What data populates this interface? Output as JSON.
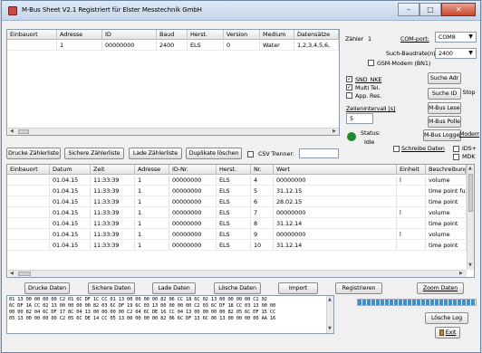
{
  "window": {
    "title": "M-Bus Sheet  V2.1 Registriert für Elster Messtechnik GmbH",
    "minimize_label": "–",
    "maximize_label": "□",
    "close_label": "✕"
  },
  "meters_table": {
    "headers": [
      "Einbauort",
      "Adresse",
      "ID",
      "Baud",
      "Herst.",
      "Version",
      "Medium",
      "Datensätze"
    ],
    "rows": [
      {
        "einbauort": "",
        "adresse": "1",
        "id": "00000000",
        "baud": "2400",
        "herst": "ELS",
        "version": "0",
        "medium": "Water",
        "datensaetze": "1,2,3,4,5,6,"
      }
    ]
  },
  "settings": {
    "zaehler_label": "Zähler",
    "zaehler_value": "1",
    "com_port_label": "COM-port:",
    "com_port_value": "COM8",
    "baud_label": "Such-Baudrate(n)",
    "baud_value": "2400",
    "gsm_label": "GSM-Modem (BN1)",
    "snd_nke_label": "SND_NKE",
    "multi_tel_label": "Multi Tel.",
    "app_res_label": "App. Res.",
    "zeilenintervall_label": "Zeilenintervall [s]",
    "zeilenintervall_value": "5",
    "status_label": "Status:",
    "status_value": "Idle",
    "schreibe_label": "Schreibe Daten",
    "ids_label": "IDS+",
    "mdk_label": "MDK",
    "status_color": "#1e8c2e"
  },
  "buttons": {
    "suche_adr": "Suche Adr",
    "suche_id": "Suche ID",
    "stop": "Stop",
    "mbus_lesen": "M-Bus Lesen",
    "mbus_pollen": "M-Bus Pollen",
    "mbus_loggen": "M-Bus Loggen",
    "modem": "Modem",
    "drucke_zaehlerliste": "Drucke Zählerliste",
    "sichere_zaehlerliste": "Sichere Zählerliste",
    "lade_zaehlerliste": "Lade Zählerliste",
    "duplikate_loeschen": "Duplikate löschen",
    "csv_trenner": "CSV Trenner:",
    "drucke_daten": "Drucke Daten",
    "sichere_daten": "Sichere Daten",
    "lade_daten": "Lade Daten",
    "loesche_daten": "Lösche Daten",
    "import": "Import",
    "registrieren": "Registrieren",
    "zoom_daten": "Zoom Daten",
    "loesche_log": "Lösche Log",
    "exit": "Exit"
  },
  "data_table": {
    "headers": [
      "Einbauort",
      "Datum",
      "Zeit",
      "Adresse",
      "ID-Nr.",
      "Herst.",
      "Nr.",
      "Wert",
      "Einheit",
      "Beschreibung"
    ],
    "rows": [
      {
        "einbauort": "",
        "datum": "01.04.15",
        "zeit": "11:33:39",
        "adresse": "1",
        "id": "00000000",
        "herst": "ELS",
        "nr": "4",
        "wert": "00000000",
        "einheit": "l",
        "beschreibung": "volume"
      },
      {
        "einbauort": "",
        "datum": "01.04.15",
        "zeit": "11:33:39",
        "adresse": "1",
        "id": "00000000",
        "herst": "ELS",
        "nr": "5",
        "wert": "31.12.15",
        "einheit": "",
        "beschreibung": "time point futu"
      },
      {
        "einbauort": "",
        "datum": "01.04.15",
        "zeit": "11:33:39",
        "adresse": "1",
        "id": "00000000",
        "herst": "ELS",
        "nr": "6",
        "wert": "28.02.15",
        "einheit": "",
        "beschreibung": "time point"
      },
      {
        "einbauort": "",
        "datum": "01.04.15",
        "zeit": "11:33:39",
        "adresse": "1",
        "id": "00000000",
        "herst": "ELS",
        "nr": "7",
        "wert": "00000000",
        "einheit": "l",
        "beschreibung": "volume"
      },
      {
        "einbauort": "",
        "datum": "01.04.15",
        "zeit": "11:33:39",
        "adresse": "1",
        "id": "00000000",
        "herst": "ELS",
        "nr": "8",
        "wert": "31.12.14",
        "einheit": "",
        "beschreibung": "time point"
      },
      {
        "einbauort": "",
        "datum": "01.04.15",
        "zeit": "11:33:39",
        "adresse": "1",
        "id": "00000000",
        "herst": "ELS",
        "nr": "9",
        "wert": "00000000",
        "einheit": "l",
        "beschreibung": "volume"
      },
      {
        "einbauort": "",
        "datum": "01.04.15",
        "zeit": "11:33:39",
        "adresse": "1",
        "id": "00000000",
        "herst": "ELS",
        "nr": "10",
        "wert": "31.12.14",
        "einheit": "",
        "beschreibung": "time point"
      }
    ]
  },
  "log": {
    "lines": [
      "01 13 00 00 00 00 C2 01 6C DF 1C CC 01 13 00 00 00 00 82 06 CC 18 6C 02 13 00 00 00 00 C2 02",
      "6C DF 1A CC 02 13 00 00 00 00 82 03 6C DF 19 6C 03 13 00 00 00 00 C2 03 6C DF 18 CC 03 13 00 00",
      "00 00 82 04 6C DF 17 8C 04 13 00 00 00 00 C2 04 6C DE 16 CC 04 13 00 00 00 00 82 05 6C DF 15 CC",
      "05 13 00 00 00 00 C2 05 6C DE 14 CC 05 13 00 00 00 00 82 06 6C DF 13 6C 06 13 00 00 00 00 AA 16"
    ]
  },
  "progress": {
    "fraction": 1.0,
    "color": "#3a8fd6"
  }
}
